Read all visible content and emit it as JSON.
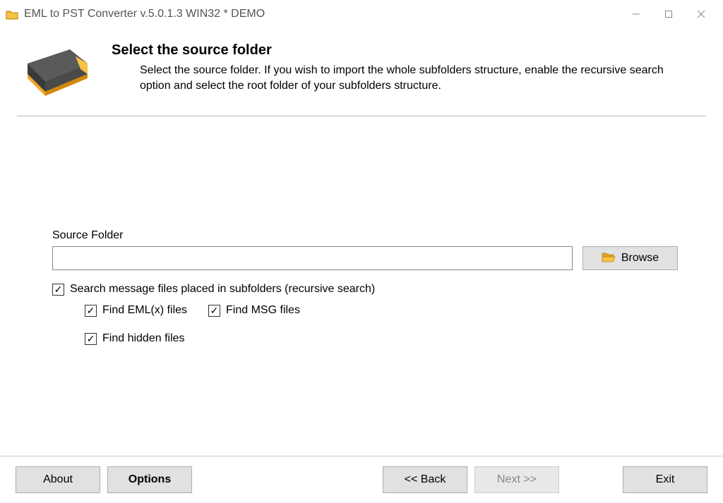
{
  "window": {
    "title": "EML to PST Converter v.5.0.1.3 WIN32 * DEMO"
  },
  "header": {
    "title": "Select the source folder",
    "description": "Select the source folder. If you wish to import the whole subfolders structure, enable the recursive search option and select the root folder of your subfolders structure."
  },
  "form": {
    "source_label": "Source Folder",
    "source_value": "",
    "browse_label": "Browse",
    "checkboxes": {
      "recursive": {
        "label": "Search message files placed in subfolders (recursive search)",
        "checked": true
      },
      "find_eml": {
        "label": "Find EML(x) files",
        "checked": true
      },
      "find_msg": {
        "label": "Find MSG files",
        "checked": true
      },
      "find_hidden": {
        "label": "Find hidden files",
        "checked": true
      }
    }
  },
  "footer": {
    "about": "About",
    "options": "Options",
    "back": "<< Back",
    "next": "Next >>",
    "exit": "Exit",
    "next_enabled": false
  }
}
